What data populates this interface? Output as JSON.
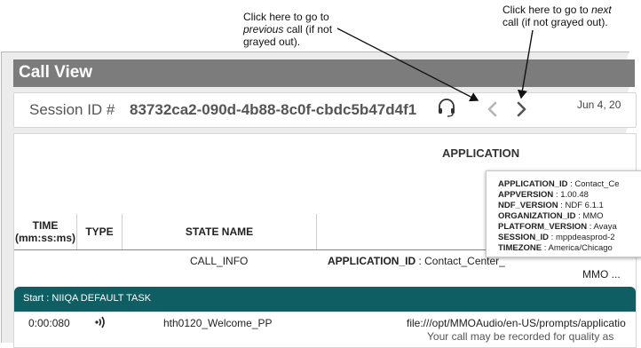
{
  "annotations": {
    "prev_line1": "Click here to go to",
    "prev_line2_italic": "previous",
    "prev_line2_rest": " call (if not",
    "prev_line3": "grayed out).",
    "next_line1": "Click here to go to ",
    "next_line1_italic": "next",
    "next_line2": "call (if not grayed out)."
  },
  "header": {
    "title": "Call View"
  },
  "session": {
    "label": "Session ID #",
    "id": "83732ca2-090d-4b88-8c0f-cbdc5b47d4f1",
    "date": "Jun 4, 20",
    "icons": [
      "headset-icon",
      "chevron-left-icon",
      "chevron-right-icon"
    ]
  },
  "table": {
    "application_header": "APPLICATION",
    "columns": {
      "time": [
        "TIME",
        "(mm:ss:ms)"
      ],
      "type": "TYPE",
      "state": "STATE NAME"
    },
    "row_call_info": {
      "state": "CALL_INFO",
      "app_key": "APPLICATION_ID",
      "app_value": " : Contact_Center_",
      "app_more": "MMO ..."
    },
    "task_bar": "Start : NIIQA DEFAULT TASK",
    "row_welcome": {
      "time": "0:00:080",
      "type_icon": "audio-icon",
      "state": "hth0120_Welcome_PP",
      "path": "file:///opt/MMOAudio/en-US/prompts/applicatio",
      "subtext": "Your call may be recorded for quality as"
    }
  },
  "tooltip": [
    {
      "key": "APPLICATION_ID",
      "value": " : Contact_Ce"
    },
    {
      "key": "APPVERSION",
      "value": " : 1.00.48"
    },
    {
      "key": "NDF_VERSION",
      "value": " : NDF 6.1.1"
    },
    {
      "key": "ORGANIZATION_ID",
      "value": " : MMO"
    },
    {
      "key": "PLATFORM_VERSION",
      "value": " : Avaya"
    },
    {
      "key": "SESSION_ID",
      "value": " : mppdeasprod-2"
    },
    {
      "key": "TIMEZONE",
      "value": " : America/Chicago"
    }
  ],
  "colors": {
    "title_bar": "#7c7c7c",
    "task_bar": "#0e5e63",
    "chevron_disabled": "#b5b5b5",
    "chevron_active": "#555555"
  }
}
